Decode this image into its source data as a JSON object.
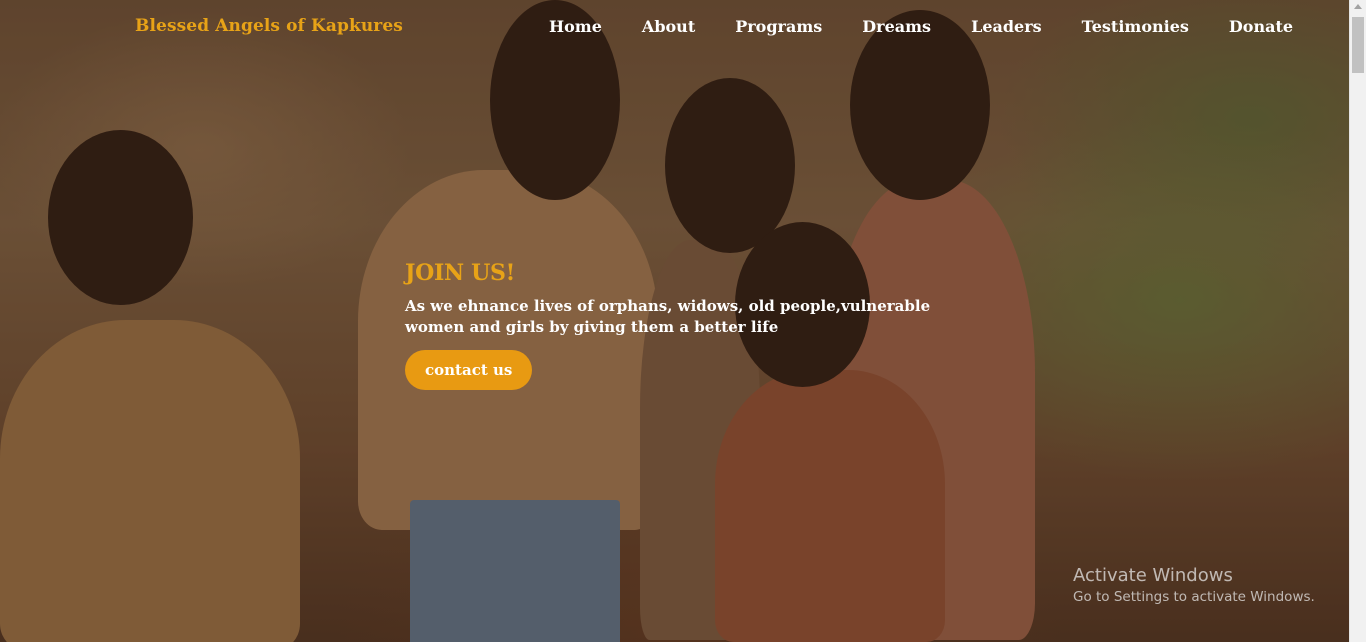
{
  "brand": {
    "name": "Blessed Angels of Kapkures"
  },
  "nav": {
    "items": [
      {
        "label": "Home"
      },
      {
        "label": "About"
      },
      {
        "label": "Programs"
      },
      {
        "label": "Dreams"
      },
      {
        "label": "Leaders"
      },
      {
        "label": "Testimonies"
      },
      {
        "label": "Donate"
      }
    ]
  },
  "hero": {
    "title": "JOIN US!",
    "text": "As we ehnance lives of orphans, widows, old people,vulnerable women and girls by giving them a better life",
    "cta_label": "contact us"
  },
  "watermark": {
    "title": "Activate Windows",
    "subtitle": "Go to Settings to activate Windows."
  },
  "colors": {
    "accent": "#e8a317",
    "button": "#e89a12",
    "nav_text": "#ffffff"
  },
  "icons": {
    "scroll_up": "chevron-up-icon"
  }
}
